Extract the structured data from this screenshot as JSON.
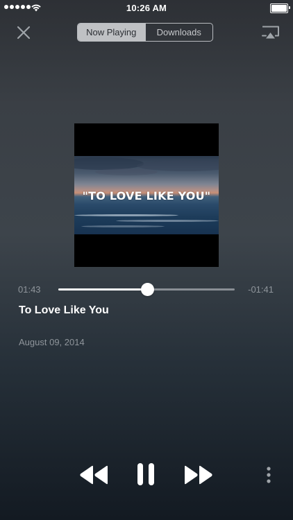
{
  "status_bar": {
    "time": "10:26 AM",
    "signal_icon": "signal-dots-icon",
    "wifi_icon": "wifi-icon",
    "battery_icon": "battery-full-icon"
  },
  "nav": {
    "close_icon": "close-icon",
    "tabs": [
      {
        "label": "Now Playing",
        "active": true
      },
      {
        "label": "Downloads",
        "active": false
      }
    ],
    "airplay_icon": "airplay-icon"
  },
  "artwork": {
    "text": "\"TO LOVE LIKE YOU\""
  },
  "playback": {
    "elapsed": "01:43",
    "remaining": "-01:41",
    "progress": 0.505
  },
  "song": {
    "title": "To Love Like You",
    "date": "August 09, 2014"
  },
  "controls": {
    "rewind_icon": "rewind-icon",
    "pause_icon": "pause-icon",
    "forward_icon": "fast-forward-icon",
    "more_icon": "more-vertical-icon"
  },
  "colors": {
    "accent": "#ffffff",
    "muted_text": "#8f959b",
    "segment_active_bg": "#bfc1c4"
  }
}
